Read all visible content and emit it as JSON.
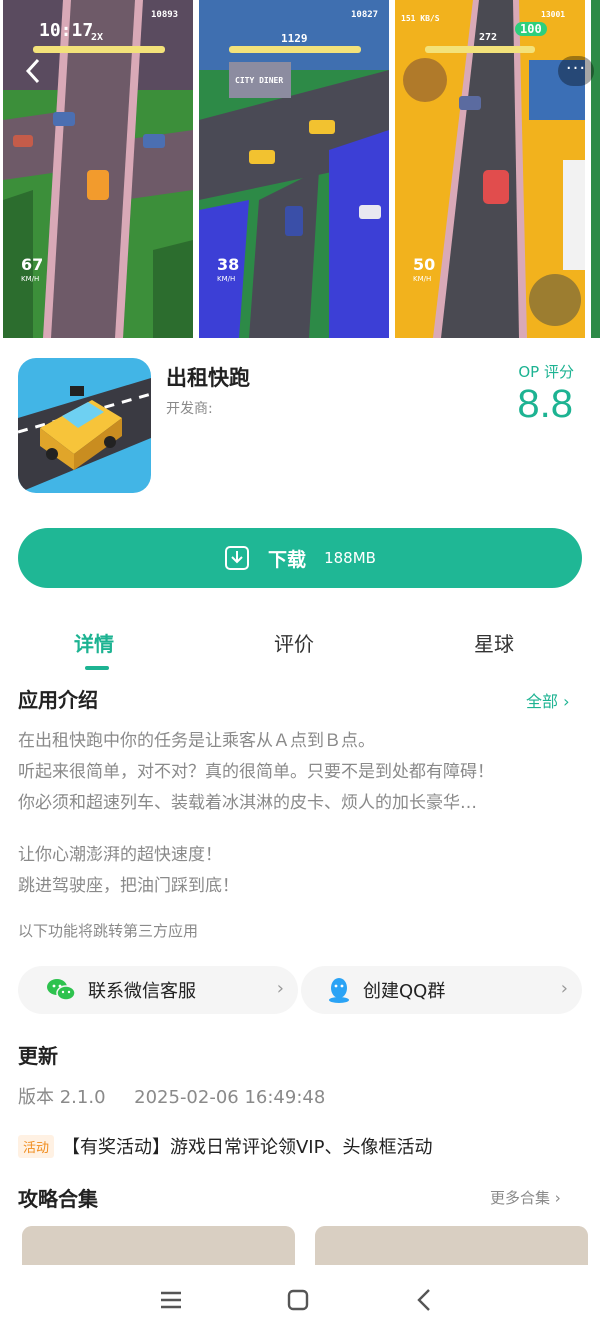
{
  "screenshots": [
    {
      "time": "10:17",
      "coins": "10893",
      "counter": "2X",
      "speed": "67",
      "speed_unit": "KM/H"
    },
    {
      "coins": "10827",
      "counter": "1129",
      "billboard": "CITY DINER",
      "speed": "38",
      "speed_unit": "KM/H"
    },
    {
      "status_rate": "151 KB/S",
      "battery": "100",
      "coins": "13001",
      "counter": "272",
      "speed": "50",
      "speed_unit": "KM/H"
    }
  ],
  "nav": {
    "back_icon": "chevron-left-icon",
    "more_label": "···"
  },
  "app": {
    "name": "出租快跑",
    "developer_label": "开发商:",
    "rating_label": "OP 评分",
    "rating_value": "8.8"
  },
  "download": {
    "label": "下载",
    "size": "188MB"
  },
  "tabs": [
    {
      "label": "详情",
      "active": true
    },
    {
      "label": "评价",
      "active": false
    },
    {
      "label": "星球",
      "active": false
    }
  ],
  "intro": {
    "title": "应用介绍",
    "all_link": "全部 ›",
    "paragraph1": [
      "在出租快跑中你的任务是让乘客从Ａ点到Ｂ点。",
      "听起来很简单，对不对？真的很简单。只要不是到处都有障碍！",
      "你必须和超速列车、装载着冰淇淋的皮卡、烦人的加长豪华…"
    ],
    "paragraph2": [
      "让你心潮澎湃的超快速度！",
      "跳进驾驶座，把油门踩到底！"
    ],
    "third_party_note": "以下功能将跳转第三方应用"
  },
  "services": {
    "wechat_label": "联系微信客服",
    "qq_label": "创建QQ群"
  },
  "update": {
    "title": "更新",
    "version_line": "版本 2.1.0     2025-02-06 16:49:48",
    "badge": "活动",
    "event_text": "【有奖活动】游戏日常评论领VIP、头像框活动"
  },
  "guides": {
    "title": "攻略合集",
    "more_link": "更多合集 ›"
  },
  "colors": {
    "accent": "#1fb795",
    "badge_bg": "#fff1e3",
    "badge_text": "#f08c1c"
  }
}
